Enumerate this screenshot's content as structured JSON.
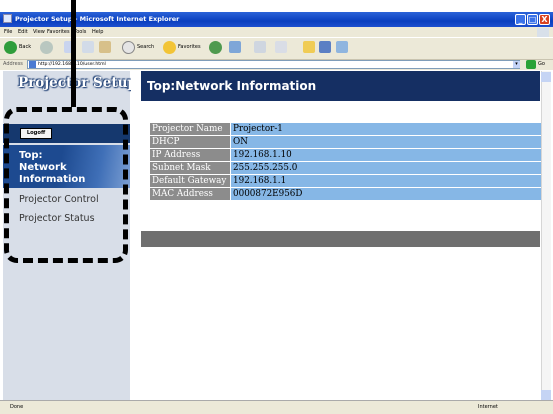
{
  "window": {
    "title": "Projector Setup - Microsoft Internet Explorer",
    "controls": {
      "minimize": "_",
      "maximize": "□",
      "close": "X"
    }
  },
  "menu": {
    "items": [
      "File",
      "Edit",
      "View",
      "Favorites",
      "Tools",
      "Help"
    ]
  },
  "toolbar": {
    "back": "Back",
    "search": "Search",
    "favorites": "Favorites"
  },
  "address": {
    "label": "Address",
    "value": "http://192.168.1.10/user.html",
    "go": "Go"
  },
  "sidebar": {
    "title": "Projector Setup",
    "logoff": "Logoff",
    "items": [
      {
        "lines": [
          "Top:",
          "Network",
          "Information"
        ],
        "active": true
      },
      {
        "label": "Projector Control",
        "active": false
      },
      {
        "label": "Projector Status",
        "active": false
      }
    ]
  },
  "page": {
    "title": "Top:Network Information",
    "table": [
      {
        "label": "Projector Name",
        "value": "Projector-1"
      },
      {
        "label": "DHCP",
        "value": "ON"
      },
      {
        "label": "IP Address",
        "value": "192.168.1.10"
      },
      {
        "label": "Subnet Mask",
        "value": "255.255.255.0"
      },
      {
        "label": "Default Gateway",
        "value": "192.168.1.1"
      },
      {
        "label": "MAC Address",
        "value": "0000872E956D"
      }
    ]
  },
  "status": {
    "left": "Done",
    "right": "Internet"
  },
  "colors": {
    "header_band": "#152f63",
    "label_cell": "#8c8c8c",
    "value_cell": "#86b7e6",
    "sidebar_bg": "#d8dee8",
    "footer_band": "#6f6f6f"
  }
}
